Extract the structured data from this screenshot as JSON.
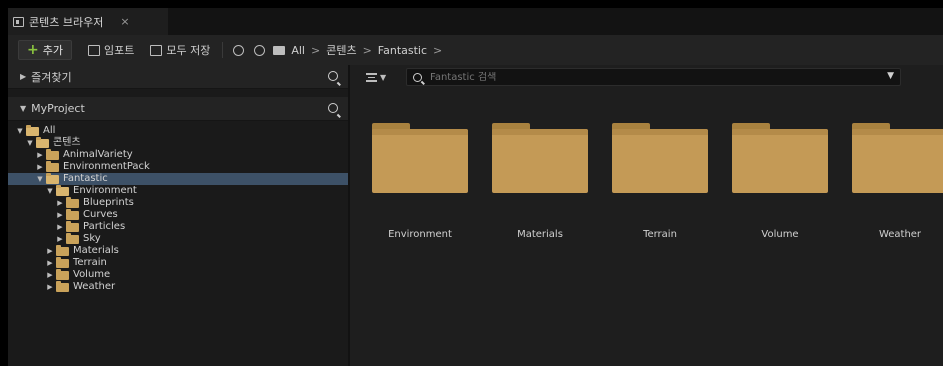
{
  "window": {
    "tab_title": "콘텐츠 브라우저",
    "tab_close": "×"
  },
  "toolbar": {
    "add_label": "추가",
    "import_label": "임포트",
    "save_all_label": "모두 저장",
    "breadcrumbs": [
      "All",
      "콘텐츠",
      "Fantastic"
    ],
    "crumb_sep": ">"
  },
  "left": {
    "favorites_label": "즐겨찾기",
    "project_label": "MyProject",
    "tree": [
      {
        "label": "All",
        "depth": 0,
        "expanded": true,
        "selected": false
      },
      {
        "label": "콘텐츠",
        "depth": 1,
        "expanded": true,
        "selected": false
      },
      {
        "label": "AnimalVariety",
        "depth": 2,
        "expanded": false,
        "selected": false
      },
      {
        "label": "EnvironmentPack",
        "depth": 2,
        "expanded": false,
        "selected": false
      },
      {
        "label": "Fantastic",
        "depth": 2,
        "expanded": true,
        "selected": true
      },
      {
        "label": "Environment",
        "depth": 3,
        "expanded": true,
        "selected": false
      },
      {
        "label": "Blueprints",
        "depth": 4,
        "expanded": false,
        "selected": false
      },
      {
        "label": "Curves",
        "depth": 4,
        "expanded": false,
        "selected": false
      },
      {
        "label": "Particles",
        "depth": 4,
        "expanded": false,
        "selected": false
      },
      {
        "label": "Sky",
        "depth": 4,
        "expanded": false,
        "selected": false
      },
      {
        "label": "Materials",
        "depth": 3,
        "expanded": false,
        "selected": false
      },
      {
        "label": "Terrain",
        "depth": 3,
        "expanded": false,
        "selected": false
      },
      {
        "label": "Volume",
        "depth": 3,
        "expanded": false,
        "selected": false
      },
      {
        "label": "Weather",
        "depth": 3,
        "expanded": false,
        "selected": false
      }
    ]
  },
  "content": {
    "search_placeholder": "Fantastic 검색",
    "folders": [
      "Environment",
      "Materials",
      "Terrain",
      "Volume",
      "Weather"
    ]
  },
  "colors": {
    "folder": "#c49a56",
    "selection": "#3d5167",
    "add_accent": "#8ac43f"
  }
}
